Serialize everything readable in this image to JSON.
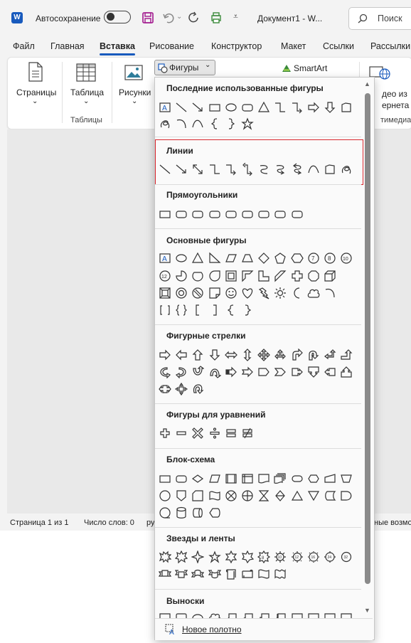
{
  "titlebar": {
    "autosave": "Автосохранение",
    "doc_title": "Документ1 - W...",
    "search": "Поиск"
  },
  "tabs": [
    "Файл",
    "Главная",
    "Вставка",
    "Рисование",
    "Конструктор",
    "Макет",
    "Ссылки",
    "Рассылки"
  ],
  "ribbon": {
    "pages": "Страницы",
    "table": "Таблица",
    "tables_group": "Таблицы",
    "pictures": "Рисунки",
    "shapes": "Фигуры",
    "smartart": "SmartArt",
    "video_l1": "део из",
    "video_l2": "ернета",
    "media_group": "тимедиа"
  },
  "status": {
    "page": "Страница 1 из 1",
    "words": "Число слов: 0",
    "lang": "ру",
    "access": "ные возмо"
  },
  "shapes_menu": {
    "sections": {
      "recent": "Последние использованные фигуры",
      "lines": "Линии",
      "rects": "Прямоугольники",
      "basic": "Основные фигуры",
      "arrows": "Фигурные стрелки",
      "equation": "Фигуры для уравнений",
      "flowchart": "Блок-схема",
      "stars": "Звезды и ленты",
      "callouts": "Выноски"
    },
    "new_canvas": "Новое полотно"
  },
  "colors": {
    "accent": "#185abd",
    "highlight": "#d9262d",
    "word_blue": "#185abd",
    "save_purple": "#a0148c",
    "smartart_green": "#3a8a3a"
  }
}
